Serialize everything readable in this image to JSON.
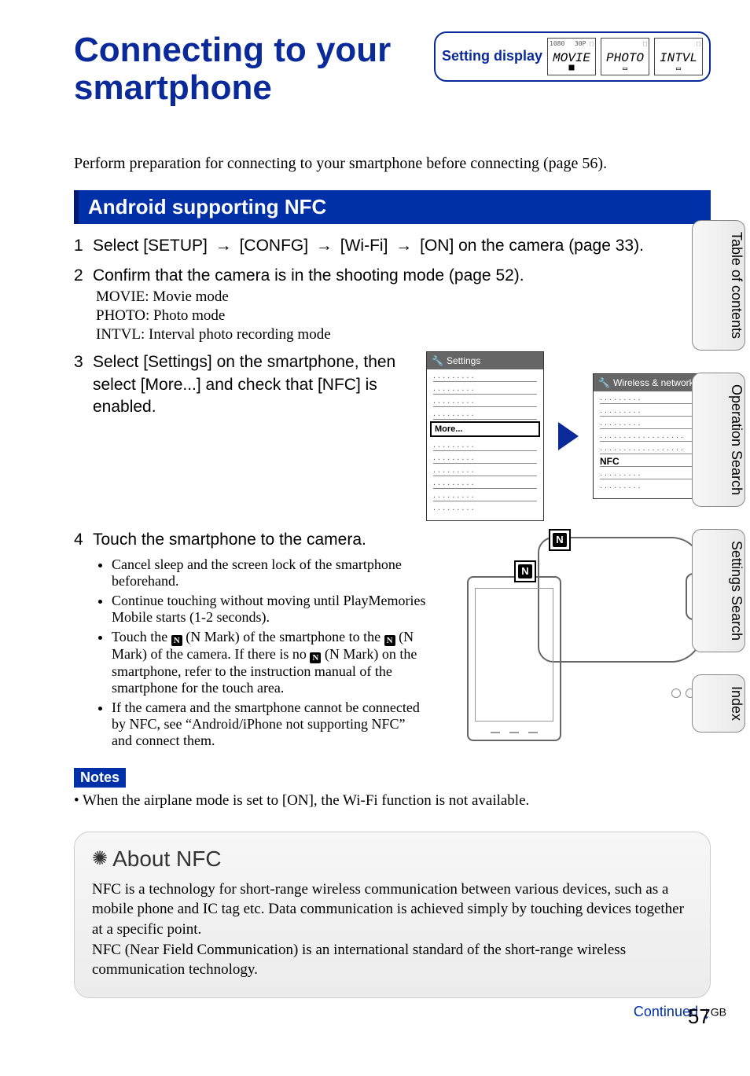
{
  "title": "Connecting to your smartphone",
  "setting_display_label": "Setting display",
  "display_icons": {
    "movie": "MOVIE",
    "photo": "PHOTO",
    "intvl": "INTVL"
  },
  "intro": "Perform preparation for connecting to your smartphone before connecting (page 56).",
  "section_heading": "Android supporting NFC",
  "steps": {
    "s1": {
      "num": "1",
      "prefix": "Select [SETUP]",
      "seg2": "[CONFG]",
      "seg3": "[Wi-Fi]",
      "seg4": "[ON] on the camera (page 33)."
    },
    "s2": {
      "num": "2",
      "head": "Confirm that the camera is in the shooting mode (page 52).",
      "sub1": "MOVIE: Movie mode",
      "sub2": "PHOTO: Photo mode",
      "sub3": "INTVL: Interval photo recording mode"
    },
    "s3": {
      "num": "3",
      "head": "Select [Settings] on the smartphone, then select [More...] and check that [NFC] is enabled."
    },
    "s4": {
      "num": "4",
      "head": "Touch the smartphone to the camera.",
      "b1": "Cancel sleep and the screen lock of the smartphone beforehand.",
      "b2": "Continue touching without moving until PlayMemories Mobile starts (1-2 seconds).",
      "b3a": "Touch the ",
      "b3b": " (N Mark) of the smartphone to the ",
      "b3c": " (N Mark) of the camera. If there is no ",
      "b3d": " (N Mark) on the smartphone, refer to the instruction manual of the smartphone for the touch area.",
      "b4": "If the camera and the smartphone cannot be connected by NFC, see “Android/iPhone not supporting NFC” and connect them."
    }
  },
  "phone1": {
    "header": "Settings",
    "more": "More..."
  },
  "phone2": {
    "header": "Wireless & networks",
    "nfc": "NFC"
  },
  "notes": {
    "label": "Notes",
    "body": "• When the airplane mode is set to [ON], the Wi-Fi function is not available."
  },
  "infobox": {
    "title": "About NFC",
    "body": "NFC is a technology for short-range wireless communication between various devices, such as a mobile phone and IC tag etc. Data communication is achieved simply by touching devices together at a specific point.\nNFC (Near Field Communication) is an international standard of the short-range wireless communication technology."
  },
  "footer": {
    "page": "57",
    "gb": "GB",
    "continued": "Continued",
    "arrow": "↓"
  },
  "tabs": {
    "t1a": "Table of",
    "t1b": "contents",
    "t2a": "Operation",
    "t2b": "Search",
    "t3a": "Settings",
    "t3b": "Search",
    "t4": "Index"
  },
  "nmark_glyph": "N"
}
